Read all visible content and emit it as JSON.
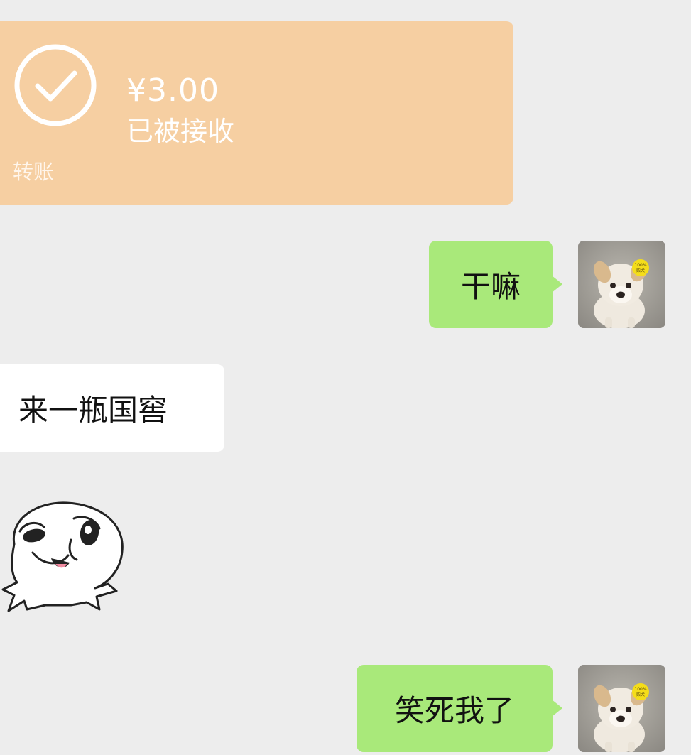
{
  "transfer": {
    "amount": "¥3.00",
    "status": "已被接收",
    "label": "转账",
    "icon": "check-circle-icon"
  },
  "messages": [
    {
      "side": "outgoing",
      "text": "干嘛"
    },
    {
      "side": "incoming",
      "text": "来一瓶国窖"
    },
    {
      "side": "incoming",
      "type": "sticker",
      "icon": "laughing-face-sticker"
    },
    {
      "side": "outgoing",
      "text": "笑死我了"
    }
  ],
  "avatar": {
    "icon": "puppy-avatar",
    "badge_text": "100%\n柴犬"
  },
  "colors": {
    "background": "#ededed",
    "transfer_card": "#f6cfa2",
    "outgoing_bubble": "#a9e97a",
    "incoming_bubble": "#ffffff"
  }
}
